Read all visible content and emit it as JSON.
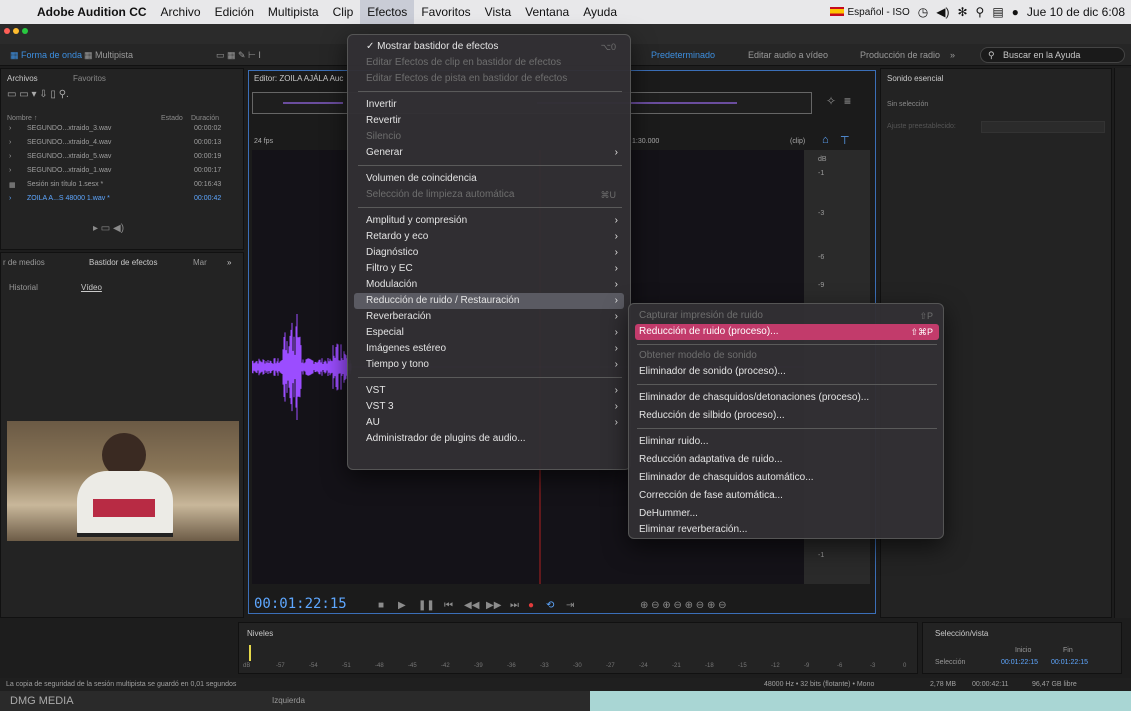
{
  "menubar": {
    "app_name": "Adobe Audition CC",
    "menus": [
      "Archivo",
      "Edición",
      "Multipista",
      "Clip",
      "Efectos",
      "Favoritos",
      "Vista",
      "Ventana",
      "Ayuda"
    ],
    "input_source": "Español - ISO",
    "clock": "Jue 10 de dic  6:08"
  },
  "toolbar": {
    "waveform_tab": "Forma de onda",
    "multitrack_tab": "Multipista",
    "workspace_default": "Predeterminado",
    "workspace_video": "Editar audio a vídeo",
    "workspace_radio": "Producción de radio",
    "search_placeholder": "Buscar en la Ayuda"
  },
  "files_panel": {
    "tab_files": "Archivos",
    "tab_favorites": "Favoritos",
    "col_name": "Nombre ↑",
    "col_state": "Estado",
    "col_duration": "Duración",
    "rows": [
      {
        "name": "SEGUNDO...xtraido_3.wav",
        "duration": "00:00:02"
      },
      {
        "name": "SEGUNDO...xtraido_4.wav",
        "duration": "00:00:13"
      },
      {
        "name": "SEGUNDO...xtraido_5.wav",
        "duration": "00:00:19"
      },
      {
        "name": "SEGUNDO...xtraido_1.wav",
        "duration": "00:00:17"
      },
      {
        "name": "Sesión sin título 1.sesx *",
        "duration": "00:16:43"
      },
      {
        "name": "ZOILA A...S 48000 1.wav *",
        "duration": "00:00:42"
      }
    ]
  },
  "left_tabs": {
    "media": "r de medios",
    "effects_rack": "Bastidor de efectos",
    "markers": "Mar",
    "history": "Historial",
    "video": "Vídeo"
  },
  "editor": {
    "title": "Editor: ZOILA AJÁLA Auc",
    "fps": "24 fps",
    "time_marker": "1:30.000",
    "clip_label": "(clip)",
    "db_label": "dB",
    "timecode": "00:01:22:15",
    "db_ticks": [
      "-1",
      "-3",
      "-6",
      "-9"
    ]
  },
  "essential_sound": {
    "title": "Sonido esencial",
    "no_selection": "Sin selección",
    "preset": "Ajuste preestablecido:"
  },
  "effects_menu": {
    "items": [
      {
        "label": "✓ Mostrar bastidor de efectos",
        "shortcut": "⌥0",
        "disabled": false
      },
      {
        "label": "Editar Efectos de clip en bastidor de efectos",
        "disabled": true
      },
      {
        "label": "Editar Efectos de pista en bastidor de efectos",
        "disabled": true
      },
      {
        "label": "Invertir",
        "disabled": false
      },
      {
        "label": "Revertir",
        "disabled": false
      },
      {
        "label": "Silencio",
        "disabled": true
      },
      {
        "label": "Generar",
        "submenu": true,
        "disabled": false
      },
      {
        "label": "Volumen de coincidencia",
        "disabled": false
      },
      {
        "label": "Selección de limpieza automática",
        "shortcut": "⌘U",
        "disabled": true
      },
      {
        "label": "Amplitud y compresión",
        "submenu": true
      },
      {
        "label": "Retardo y eco",
        "submenu": true
      },
      {
        "label": "Diagnóstico",
        "submenu": true
      },
      {
        "label": "Filtro y EC",
        "submenu": true
      },
      {
        "label": "Modulación",
        "submenu": true
      },
      {
        "label": "Reducción de ruido / Restauración",
        "submenu": true,
        "highlighted": true
      },
      {
        "label": "Reverberación",
        "submenu": true
      },
      {
        "label": "Especial",
        "submenu": true
      },
      {
        "label": "Imágenes estéreo",
        "submenu": true
      },
      {
        "label": "Tiempo y tono",
        "submenu": true
      },
      {
        "label": "VST",
        "submenu": true
      },
      {
        "label": "VST 3",
        "submenu": true
      },
      {
        "label": "AU",
        "submenu": true
      },
      {
        "label": "Administrador de plugins de audio..."
      }
    ]
  },
  "noise_submenu": {
    "items": [
      {
        "label": "Capturar impresión de ruido",
        "shortcut": "⇧P",
        "disabled": true
      },
      {
        "label": "Reducción de ruido (proceso)...",
        "shortcut": "⇧⌘P",
        "highlighted": true
      },
      {
        "label": "Obtener modelo de sonido",
        "disabled": true
      },
      {
        "label": "Eliminador de sonido (proceso)..."
      },
      {
        "label": "Eliminador de chasquidos/detonaciones (proceso)..."
      },
      {
        "label": "Reducción de silbido (proceso)..."
      },
      {
        "label": "Eliminar ruido..."
      },
      {
        "label": "Reducción adaptativa de ruido..."
      },
      {
        "label": "Eliminador de chasquidos automático..."
      },
      {
        "label": "Corrección de fase automática..."
      },
      {
        "label": "DeHummer..."
      },
      {
        "label": "Eliminar reverberación..."
      }
    ]
  },
  "levels": {
    "title": "Niveles",
    "ticks": [
      "dB",
      "-57",
      "-54",
      "-51",
      "-48",
      "-45",
      "-42",
      "-39",
      "-36",
      "-33",
      "-30",
      "-27",
      "-24",
      "-21",
      "-18",
      "-15",
      "-12",
      "-9",
      "-6",
      "-3",
      "0"
    ]
  },
  "selection_view": {
    "title": "Selección/vista",
    "start_label": "Inicio",
    "end_label": "Fin",
    "row_label": "Selección",
    "start": "00:01:22:15",
    "end": "00:01:22:15"
  },
  "status": {
    "left": "La copia de seguridad de la sesión multipista se guardó en 0,01 segundos",
    "format": "48000 Hz • 32 bits (flotante) • Mono",
    "size": "2,78 MB",
    "duration": "00:00:42:11",
    "free": "96,47 GB libre"
  },
  "dock": {
    "left": "DMG MEDIA",
    "center": "Izquierda"
  },
  "colors": {
    "accent_blue": "#3d8fe0",
    "highlight_pink": "#c23b6b",
    "waveform": "#9b4dff"
  }
}
